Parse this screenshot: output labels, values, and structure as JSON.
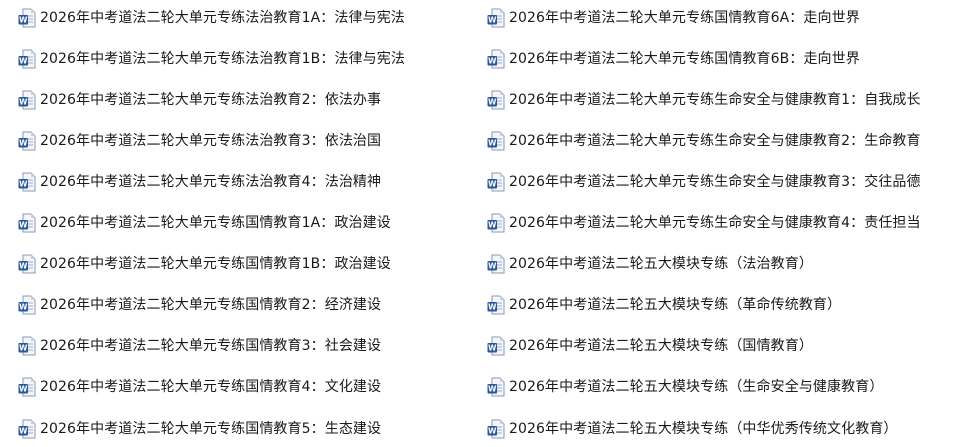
{
  "icon": {
    "name": "word-document-icon",
    "accent": "#2b579a",
    "page": "#f4f6fa",
    "fold": "#c9d3e6"
  },
  "files": {
    "left": [
      {
        "name": "2026年中考道法二轮大单元专练法治教育1A：法律与宪法"
      },
      {
        "name": "2026年中考道法二轮大单元专练法治教育1B：法律与宪法"
      },
      {
        "name": "2026年中考道法二轮大单元专练法治教育2：依法办事"
      },
      {
        "name": "2026年中考道法二轮大单元专练法治教育3：依法治国"
      },
      {
        "name": "2026年中考道法二轮大单元专练法治教育4：法治精神"
      },
      {
        "name": "2026年中考道法二轮大单元专练国情教育1A：政治建设"
      },
      {
        "name": "2026年中考道法二轮大单元专练国情教育1B：政治建设"
      },
      {
        "name": "2026年中考道法二轮大单元专练国情教育2：经济建设"
      },
      {
        "name": "2026年中考道法二轮大单元专练国情教育3：社会建设"
      },
      {
        "name": "2026年中考道法二轮大单元专练国情教育4：文化建设"
      },
      {
        "name": "2026年中考道法二轮大单元专练国情教育5：生态建设"
      }
    ],
    "right": [
      {
        "name": "2026年中考道法二轮大单元专练国情教育6A：走向世界"
      },
      {
        "name": "2026年中考道法二轮大单元专练国情教育6B：走向世界"
      },
      {
        "name": "2026年中考道法二轮大单元专练生命安全与健康教育1：自我成长"
      },
      {
        "name": "2026年中考道法二轮大单元专练生命安全与健康教育2：生命教育"
      },
      {
        "name": "2026年中考道法二轮大单元专练生命安全与健康教育3：交往品德"
      },
      {
        "name": "2026年中考道法二轮大单元专练生命安全与健康教育4：责任担当"
      },
      {
        "name": "2026年中考道法二轮五大模块专练（法治教育）"
      },
      {
        "name": "2026年中考道法二轮五大模块专练（革命传统教育）"
      },
      {
        "name": "2026年中考道法二轮五大模块专练（国情教育）"
      },
      {
        "name": "2026年中考道法二轮五大模块专练（生命安全与健康教育）"
      },
      {
        "name": "2026年中考道法二轮五大模块专练（中华优秀传统文化教育）"
      }
    ]
  }
}
